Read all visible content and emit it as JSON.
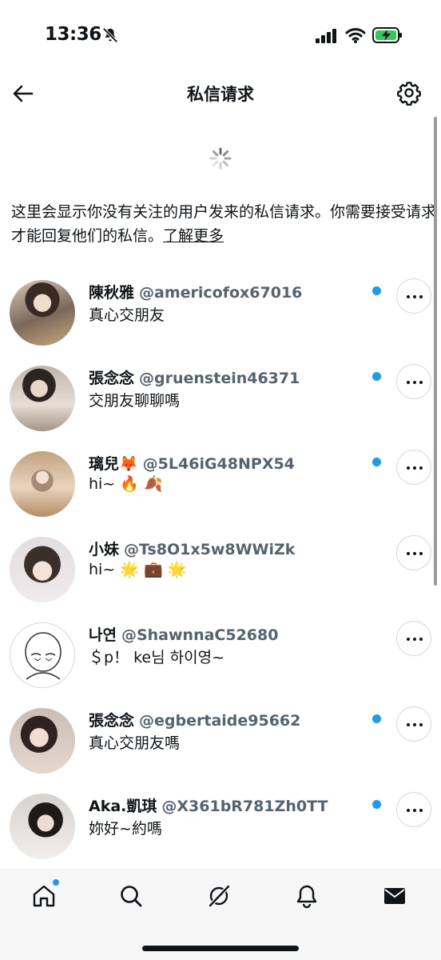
{
  "status": {
    "time": "13:36"
  },
  "header": {
    "title": "私信请求"
  },
  "info": {
    "text": "这里会显示你没有关注的用户发来的私信请求。你需要接受请求才能回复他们的私信。",
    "link": "了解更多"
  },
  "requests": [
    {
      "name": "陳秋雅",
      "handle": "@americofox67016",
      "message": "真心交朋友",
      "unread": true
    },
    {
      "name": "張念念",
      "handle": "@gruenstein46371",
      "message": "交朋友聊聊嗎",
      "unread": true
    },
    {
      "name": "璃兒🦊",
      "handle": "@5L46iG48NPX54",
      "message": "hi~ 🔥 🍂",
      "unread": true
    },
    {
      "name": "小妹",
      "handle": "@Ts8O1x5w8WWiZk",
      "message": "hi~ 🌟 💼 🌟",
      "unread": false
    },
    {
      "name": "나연",
      "handle": "@ShawnnaC52680",
      "message": "＄p！ ke님 하이영~",
      "unread": false
    },
    {
      "name": "張念念",
      "handle": "@egbertaide95662",
      "message": "真心交朋友嗎",
      "unread": true
    },
    {
      "name": "Aka.凱琪",
      "handle": "@X361bR781Zh0TT",
      "message": "妳好~約嗎",
      "unread": true
    }
  ],
  "colors": {
    "accent": "#1d9bf0",
    "text": "#0f1419",
    "secondary": "#536471"
  },
  "tabs": [
    "home-icon",
    "search-icon",
    "grok-icon",
    "notifications-icon",
    "messages-icon"
  ]
}
